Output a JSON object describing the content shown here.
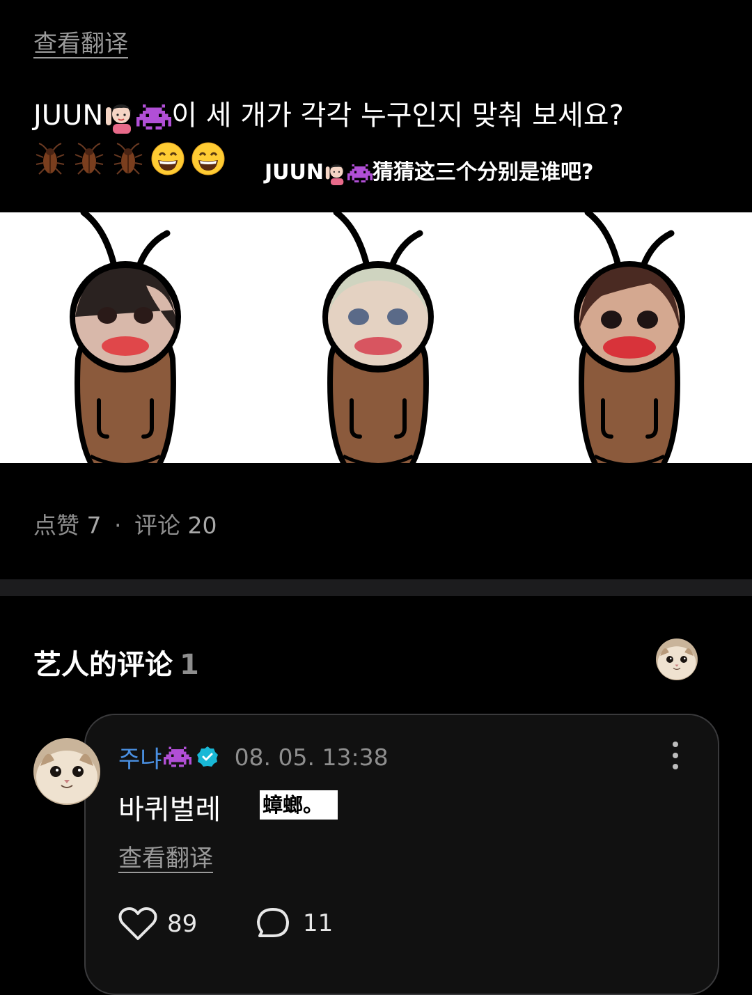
{
  "post": {
    "translate_link": "查看翻译",
    "name_prefix": "JUUN",
    "text_korean": "이 세 개가 각각 누구인지 맞춰 보세요?",
    "overlay_translation": "猜猜这三个分别是谁吧?",
    "inline_emojis": [
      "woman-raising-hand-icon",
      "space-invader-icon"
    ],
    "trailing_emojis": [
      "cockroach-icon",
      "cockroach-icon",
      "cockroach-icon",
      "grinning-face-icon",
      "grinning-face-icon"
    ]
  },
  "image": {
    "description_icons": [
      "cockroach-character-1",
      "cockroach-character-2",
      "cockroach-character-3"
    ]
  },
  "stats": {
    "likes_label": "点赞",
    "likes_count": "7",
    "separator": "·",
    "comments_label": "评论",
    "comments_count": "20"
  },
  "artist_comments": {
    "title": "艺人的评论",
    "count": "1"
  },
  "comment": {
    "author": "주냐",
    "timestamp": "08. 05. 13:38",
    "body": "바퀴벌레",
    "inline_translation": "蟑螂。",
    "translate_link": "查看翻译",
    "like_count": "89",
    "reply_count": "11"
  },
  "colors": {
    "background": "#000000",
    "author_blue": "#4a90e2",
    "verified_teal": "#19b8d6",
    "muted_gray": "#8e8e8e",
    "card_border": "#3a3a3c",
    "invader_purple": "#b14fd6",
    "cockroach_brown": "#8a5a3c"
  }
}
